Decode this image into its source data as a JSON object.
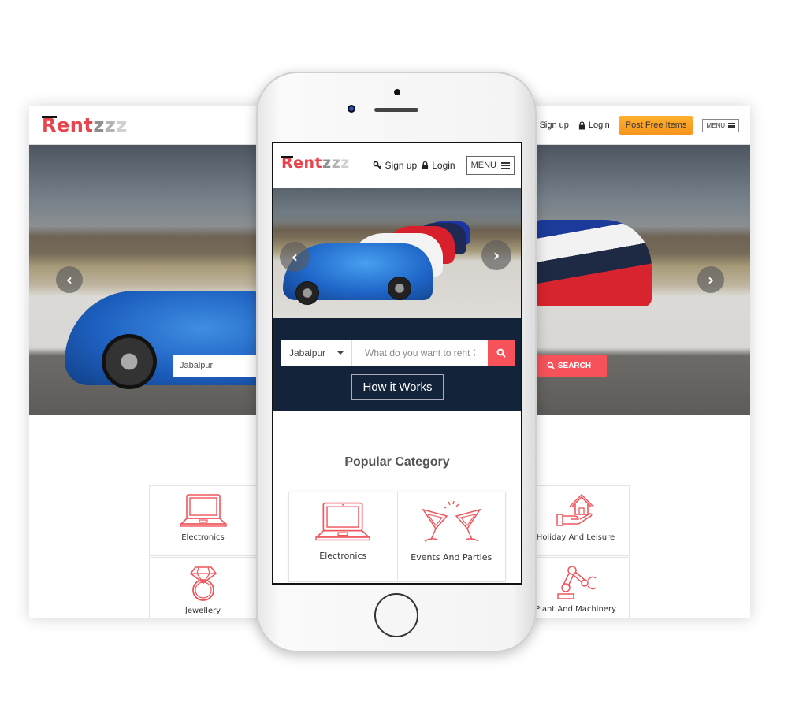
{
  "brand": {
    "logo_r": "R",
    "logo_ent": "ent",
    "logo_z": [
      "z",
      "z",
      "z"
    ],
    "accent": "#f7525a",
    "dark_band": "#13243a",
    "post_button_color": "#f7951d"
  },
  "desktop": {
    "nav": {
      "signup": "Sign up",
      "login": "Login",
      "post": "Post Free Items",
      "menu": "MENU"
    },
    "hero": {
      "prev": "‹",
      "next": "›",
      "city": "Jabalpur",
      "search": "SEARCH"
    },
    "categories": [
      {
        "label": "Electronics",
        "icon": "laptop-icon"
      },
      {
        "label": "Jewellery",
        "icon": "ring-icon"
      },
      {
        "label": "Holiday And Leisure",
        "icon": "house-in-hand-icon"
      },
      {
        "label": "Plant And Machinery",
        "icon": "robot-arm-icon"
      }
    ]
  },
  "mobile": {
    "nav": {
      "signup": "Sign up",
      "login": "Login",
      "menu": "MENU"
    },
    "hero": {
      "prev": "‹",
      "next": "›"
    },
    "search": {
      "city": "Jabalpur",
      "placeholder": "What do you want to rent ?"
    },
    "how_it_works": "How it Works",
    "popular_title": "Popular Category",
    "categories": [
      {
        "label": "Electronics",
        "icon": "laptop-icon"
      },
      {
        "label": "Events And Parties",
        "icon": "cocktail-glasses-icon"
      }
    ]
  }
}
